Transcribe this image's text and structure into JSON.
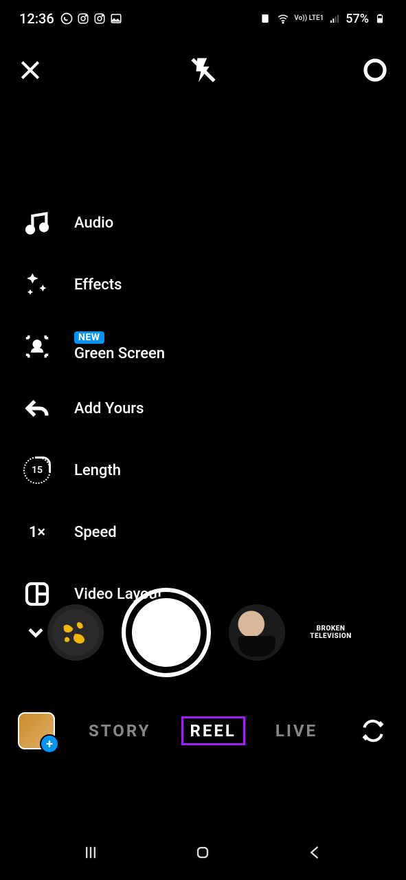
{
  "status": {
    "time": "12:36",
    "battery_text": "57%",
    "network_label": "Vo)) LTE1"
  },
  "tools": {
    "audio": "Audio",
    "effects": "Effects",
    "green_screen": "Green Screen",
    "green_screen_badge": "NEW",
    "add_yours": "Add Yours",
    "length": "Length",
    "length_value": "15",
    "speed": "Speed",
    "speed_value": "1×",
    "video_layout": "Video Layout"
  },
  "effects_carousel": {
    "broken_tv_line1": "BROKEN",
    "broken_tv_line2": "TELEVISION"
  },
  "modes": {
    "story": "STORY",
    "reel": "REEL",
    "live": "LIVE"
  }
}
